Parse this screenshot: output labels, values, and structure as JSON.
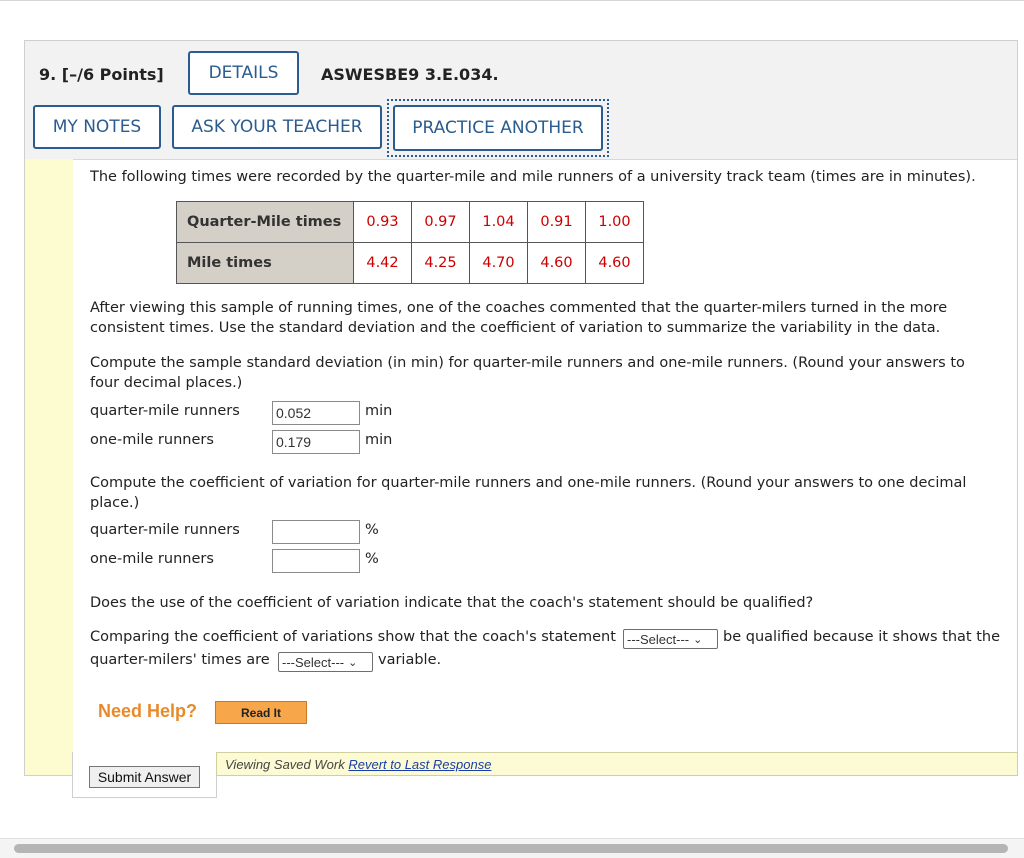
{
  "question": {
    "number_label": "9. [–/6 Points]",
    "details_label": "DETAILS",
    "code": "ASWESBE9 3.E.034.",
    "my_notes_label": "MY NOTES",
    "ask_teacher_label": "ASK YOUR TEACHER",
    "practice_another_label": "PRACTICE ANOTHER"
  },
  "intro": "The following times were recorded by the quarter-mile and mile runners of a university track team (times are in minutes).",
  "table": {
    "rows": [
      {
        "label": "Quarter-Mile times",
        "values": [
          "0.93",
          "0.97",
          "1.04",
          "0.91",
          "1.00"
        ]
      },
      {
        "label": "Mile times",
        "values": [
          "4.42",
          "4.25",
          "4.70",
          "4.60",
          "4.60"
        ]
      }
    ]
  },
  "para1_line1": "After viewing this sample of running times, one of the coaches commented that the quarter-milers turned in the more",
  "para1_line2": "consistent times. Use the standard deviation and the coefficient of variation to summarize the variability in the data.",
  "sd": {
    "prompt_line1": "Compute the sample standard deviation (in min) for quarter-mile runners and one-mile runners. (Round your answers to",
    "prompt_line2": "four decimal places.)",
    "quarter_label": "quarter-mile runners",
    "quarter_value": "0.052",
    "one_label": "one-mile runners",
    "one_value": "0.179",
    "unit": "min"
  },
  "cv": {
    "prompt_line1": "Compute the coefficient of variation for quarter-mile runners and one-mile runners. (Round your answers to one decimal",
    "prompt_line2": "place.)",
    "quarter_label": "quarter-mile runners",
    "quarter_value": "",
    "one_label": "one-mile runners",
    "one_value": "",
    "unit": "%"
  },
  "qualify_question": "Does the use of the coefficient of variation indicate that the coach's statement should be qualified?",
  "comparing": {
    "part1": "Comparing the coefficient of variations show that the coach's statement",
    "select1": "---Select---",
    "part2": "be qualified because it shows that the",
    "part3": "quarter-milers' times are",
    "select2": "---Select---",
    "part4": "variable."
  },
  "help": {
    "need_help": "Need Help?",
    "read_it": "Read It"
  },
  "footer": {
    "viewing_saved": "Viewing Saved Work",
    "revert": "Revert to Last Response",
    "submit": "Submit Answer"
  },
  "colors": {
    "accent_blue": "#2a5c8f",
    "table_value_red": "#cc0000",
    "sidebar_yellow": "#fcfcd0",
    "need_help_orange": "#e98a2a",
    "read_it_orange": "#f7a64a"
  }
}
